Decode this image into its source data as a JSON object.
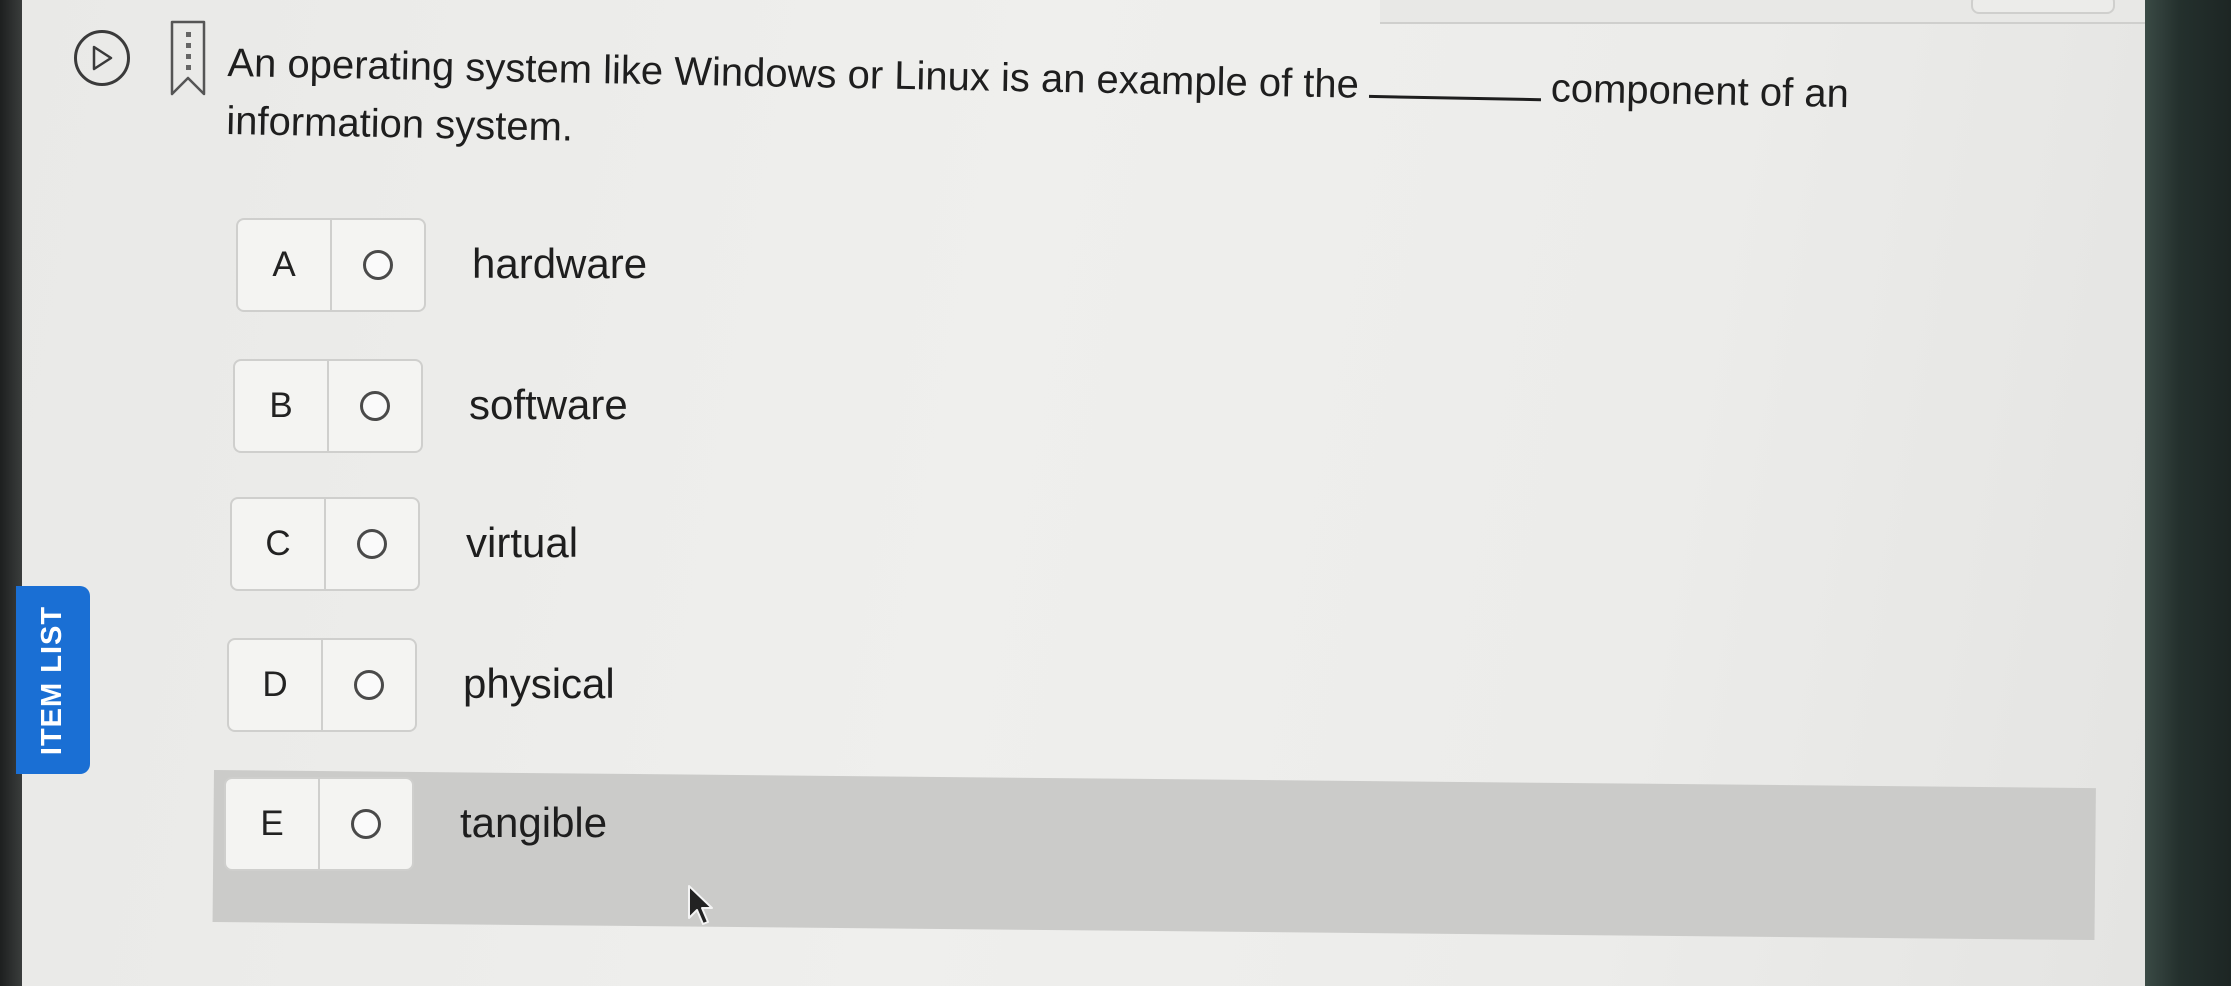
{
  "side_tab": {
    "label": "ITEM LIST",
    "color": "#1a6fd4"
  },
  "toolbar": {
    "play_icon": "play-icon",
    "bookmark_icon": "bookmark-flag-icon"
  },
  "question": {
    "text_before": "An operating system like Windows or Linux is an example of the",
    "text_after": "component of an information system."
  },
  "options": [
    {
      "letter": "A",
      "text": "hardware"
    },
    {
      "letter": "B",
      "text": "software"
    },
    {
      "letter": "C",
      "text": "virtual"
    },
    {
      "letter": "D",
      "text": "physical"
    },
    {
      "letter": "E",
      "text": "tangible"
    }
  ],
  "colors": {
    "page_background": "#ececea",
    "highlight_row": "#cbcbc9",
    "text": "#1e1e1e"
  }
}
